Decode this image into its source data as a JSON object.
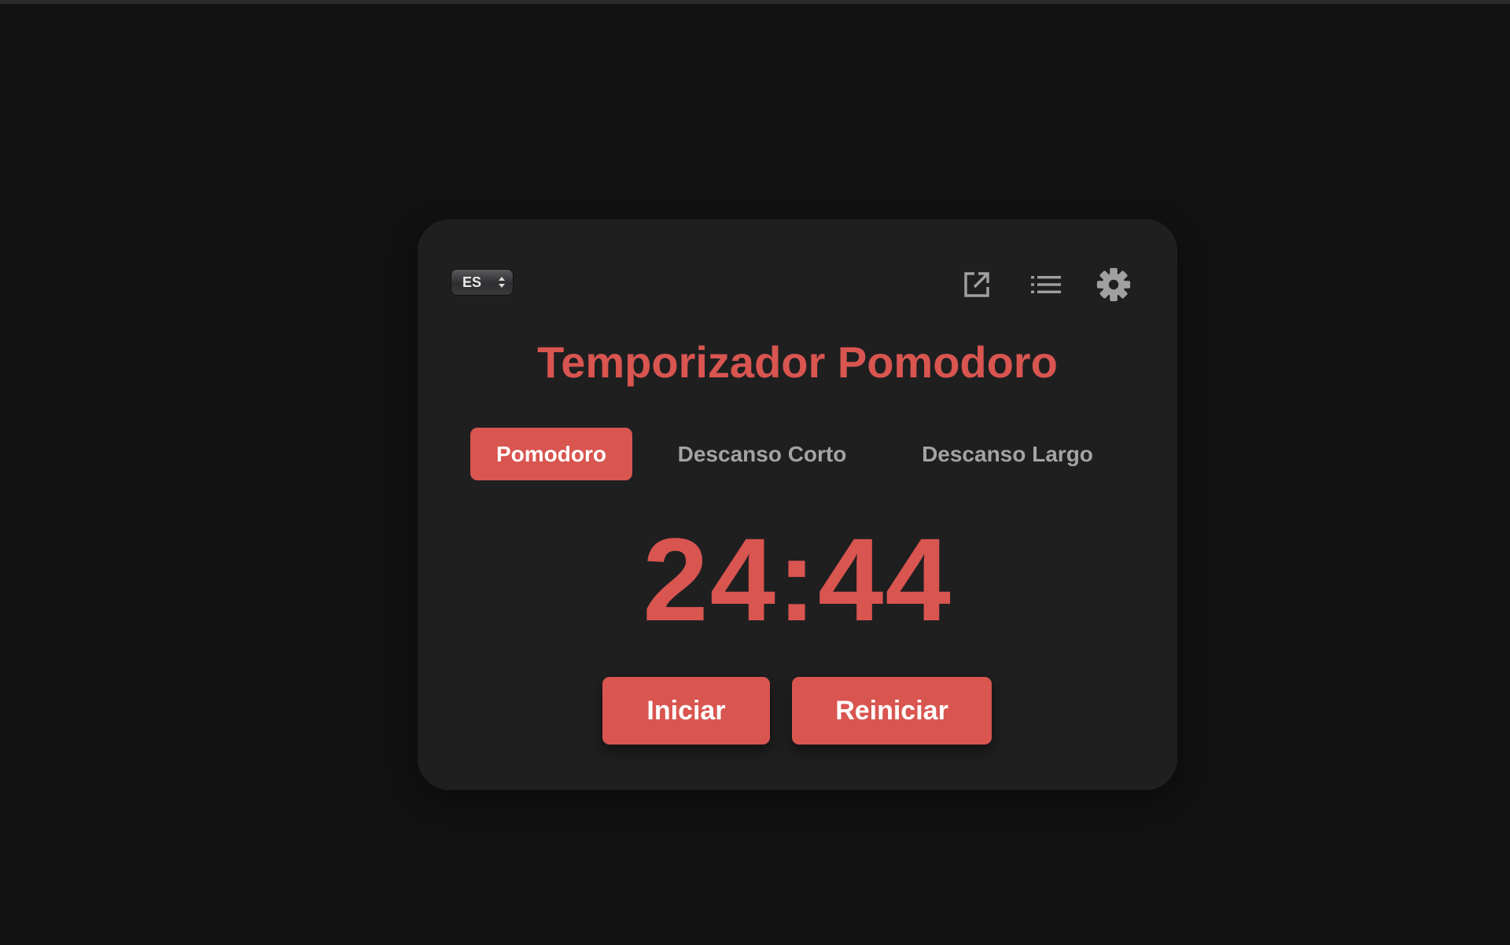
{
  "language_select": {
    "value": "ES"
  },
  "toolbar": {
    "icons": [
      "external-link-icon",
      "list-icon",
      "gear-icon"
    ]
  },
  "title": "Temporizador Pomodoro",
  "tabs": [
    {
      "label": "Pomodoro",
      "active": true
    },
    {
      "label": "Descanso Corto",
      "active": false
    },
    {
      "label": "Descanso Largo",
      "active": false
    }
  ],
  "timer": {
    "display": "24:44"
  },
  "controls": {
    "start_label": "Iniciar",
    "reset_label": "Reiniciar"
  },
  "colors": {
    "accent": "#d95550",
    "background": "#121212",
    "card": "#1f1f20",
    "inactive_text": "#a3a3a3",
    "icon": "#a0a0a0"
  }
}
